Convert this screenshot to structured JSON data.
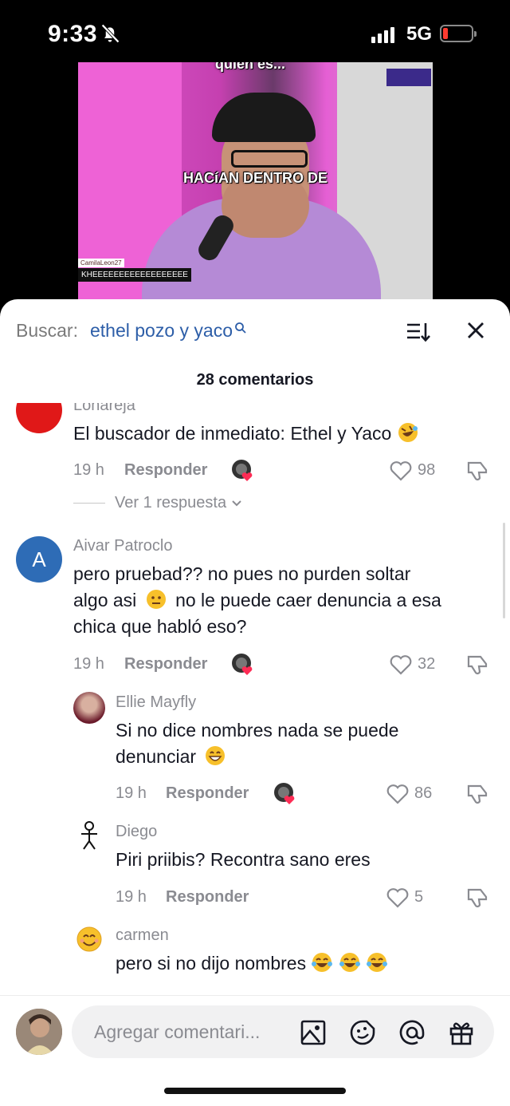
{
  "status_bar": {
    "time": "9:33",
    "network": "5G"
  },
  "video": {
    "top_caption": "quien es...",
    "subtitle": "HACíAN DENTRO DE",
    "tag_user": "CamilaLeon27",
    "tag_text": "KHEEEEEEEEEEEEEEEEEE"
  },
  "search": {
    "label": "Buscar:",
    "term": "ethel pozo y yaco"
  },
  "comment_count": "28 comentarios",
  "comments": [
    {
      "user": "Lonareja",
      "text": "El buscador de inmediato: Ethel y Yaco",
      "emoji": "rofl",
      "time": "19 h",
      "reply": "Responder",
      "likes": "98",
      "view_replies": "Ver 1 respuesta"
    },
    {
      "user": "Aivar Patroclo",
      "avatar_letter": "A",
      "text_line1": "pero pruebad?? no pues no purden soltar",
      "text_line2_a": "algo asi",
      "text_line2_b": "no le puede caer denuncia a esa",
      "text_line3": "chica que habló eso?",
      "time": "19 h",
      "reply": "Responder",
      "likes": "32"
    }
  ],
  "replies": [
    {
      "user": "Ellie Mayfly",
      "text_line1": "Si no dice nombres nada se puede",
      "text_line2": "denunciar",
      "time": "19 h",
      "reply": "Responder",
      "likes": "86"
    },
    {
      "user": "Diego",
      "text": "Piri priibis? Recontra sano eres",
      "time": "19 h",
      "reply": "Responder",
      "likes": "5"
    },
    {
      "user": "carmen",
      "text": "pero si no dijo nombres"
    }
  ],
  "composer": {
    "placeholder": "Agregar comentari..."
  },
  "colors": {
    "accent": "#2d5ea8",
    "muted": "#8a8b91",
    "text": "#161823",
    "like_heart": "#fe2c55"
  },
  "icons": [
    "bell-slash-icon",
    "search-icon",
    "sort-icon",
    "close-icon",
    "heart-icon",
    "dislike-icon",
    "image-icon",
    "emoji-icon",
    "at-icon",
    "gift-icon"
  ]
}
